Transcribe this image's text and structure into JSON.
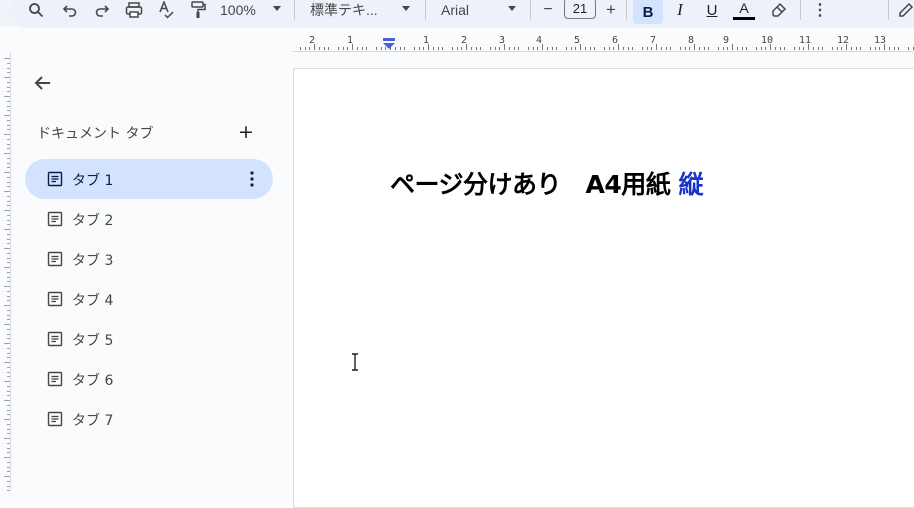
{
  "toolbar": {
    "zoom": "100%",
    "style": "標準テキ...",
    "font": "Arial",
    "font_size": "21",
    "minus": "−",
    "plus": "+",
    "bold": "B",
    "italic": "I",
    "underline": "U",
    "text_color": "A",
    "more": "⋮",
    "icons": [
      "search-icon",
      "undo-icon",
      "redo-icon",
      "print-icon",
      "spellcheck-icon",
      "paint-format-icon",
      "highlighter-icon",
      "more-vert-icon",
      "edit-icon"
    ]
  },
  "ruler": {
    "labels": [
      "2",
      "1",
      "1",
      "2",
      "3",
      "4",
      "5",
      "6",
      "7",
      "8",
      "9",
      "10",
      "11",
      "12",
      "13"
    ]
  },
  "sidebar": {
    "title": "ドキュメント タブ",
    "add": "+",
    "tabs": [
      {
        "label": "タブ 1",
        "active": true
      },
      {
        "label": "タブ 2",
        "active": false
      },
      {
        "label": "タブ 3",
        "active": false
      },
      {
        "label": "タブ 4",
        "active": false
      },
      {
        "label": "タブ 5",
        "active": false
      },
      {
        "label": "タブ 6",
        "active": false
      },
      {
        "label": "タブ 7",
        "active": false
      }
    ]
  },
  "document": {
    "heading_black": "ページ分けあり　A4用紙",
    "heading_blue": "縦"
  },
  "colors": {
    "accent": "#d3e3fd",
    "heading_blue": "#1a33c7",
    "ruler_marker": "#4a5fe0"
  }
}
